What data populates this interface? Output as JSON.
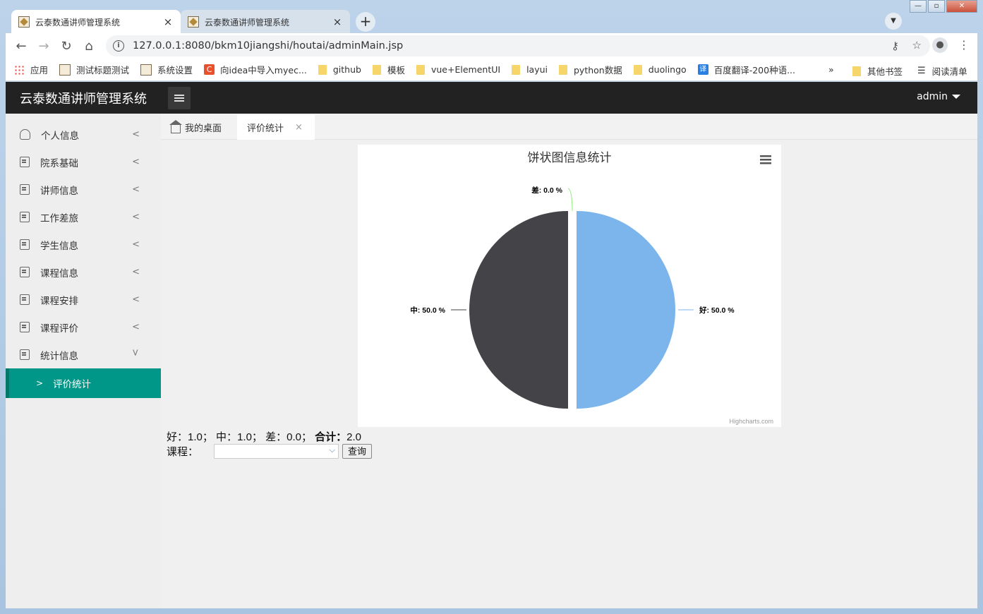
{
  "browser": {
    "tabs": [
      {
        "title": "云泰数通讲师管理系统",
        "close": "×",
        "active": true
      },
      {
        "title": "云泰数通讲师管理系统",
        "close": "×",
        "active": false
      }
    ],
    "new_tab": "+",
    "url": "127.0.0.1:8080/bkm10jiangshi/houtai/adminMain.jsp",
    "bookmarks": [
      {
        "label": "应用",
        "icon": "apps-grid-icon"
      },
      {
        "label": "测试标题测试",
        "icon": "site-favicon"
      },
      {
        "label": "系统设置",
        "icon": "site-favicon"
      },
      {
        "label": "向idea中导入myec...",
        "icon": "csdn-icon"
      },
      {
        "label": "github",
        "icon": "folder-icon"
      },
      {
        "label": "模板",
        "icon": "folder-icon"
      },
      {
        "label": "vue+ElementUI",
        "icon": "folder-icon"
      },
      {
        "label": "layui",
        "icon": "folder-icon"
      },
      {
        "label": "python数据",
        "icon": "folder-icon"
      },
      {
        "label": "duolingo",
        "icon": "folder-icon"
      },
      {
        "label": "百度翻译-200种语...",
        "icon": "translate-icon"
      }
    ],
    "bookmarks_more": "»",
    "other_bookmarks": "其他书签",
    "reading_list": "阅读清单",
    "translate_glyph": "译",
    "csdn_glyph": "C"
  },
  "app": {
    "title": "云泰数通讲师管理系统",
    "user": "admin",
    "sidebar": [
      {
        "label": "个人信息",
        "icon": "user-icon",
        "expanded": false
      },
      {
        "label": "院系基础",
        "icon": "document-icon",
        "expanded": false
      },
      {
        "label": "讲师信息",
        "icon": "document-icon",
        "expanded": false
      },
      {
        "label": "工作差旅",
        "icon": "document-icon",
        "expanded": false
      },
      {
        "label": "学生信息",
        "icon": "document-icon",
        "expanded": false
      },
      {
        "label": "课程信息",
        "icon": "document-icon",
        "expanded": false
      },
      {
        "label": "课程安排",
        "icon": "document-icon",
        "expanded": false
      },
      {
        "label": "课程评价",
        "icon": "document-icon",
        "expanded": false
      },
      {
        "label": "统计信息",
        "icon": "document-icon",
        "expanded": true
      }
    ],
    "sidebar_sub": {
      "label": "评价统计",
      "chevron": ">"
    },
    "page_tabs": [
      {
        "label": "我的桌面",
        "icon": "home-icon"
      },
      {
        "label": "评价统计",
        "close": "×"
      }
    ],
    "summary": {
      "good_label": "好：",
      "good_value": "1.0；",
      "mid_label": "中：",
      "mid_value": "1.0；",
      "bad_label": "差：",
      "bad_value": "0.0；",
      "total_label": "合计：",
      "total_value": "2.0"
    },
    "query": {
      "course_label": "课程：",
      "course_value": "",
      "button_label": "查询"
    },
    "colors": {
      "header_bg": "#222222",
      "sidebar_active": "#009688",
      "slice_good": "#7cb5ec",
      "slice_mid": "#434348",
      "slice_bad": "#90ed7d"
    }
  },
  "chart_data": {
    "type": "pie",
    "title": "饼状图信息统计",
    "credits": "Highcharts.com",
    "menu_icon": "hamburger-icon",
    "slices": [
      {
        "name": "好",
        "value": 50.0,
        "label": "好: 50.0 %",
        "color": "#7cb5ec"
      },
      {
        "name": "差",
        "value": 0.0,
        "label": "差: 0.0 %",
        "color": "#90ed7d"
      },
      {
        "name": "中",
        "value": 50.0,
        "label": "中: 50.0 %",
        "color": "#434348"
      }
    ]
  }
}
